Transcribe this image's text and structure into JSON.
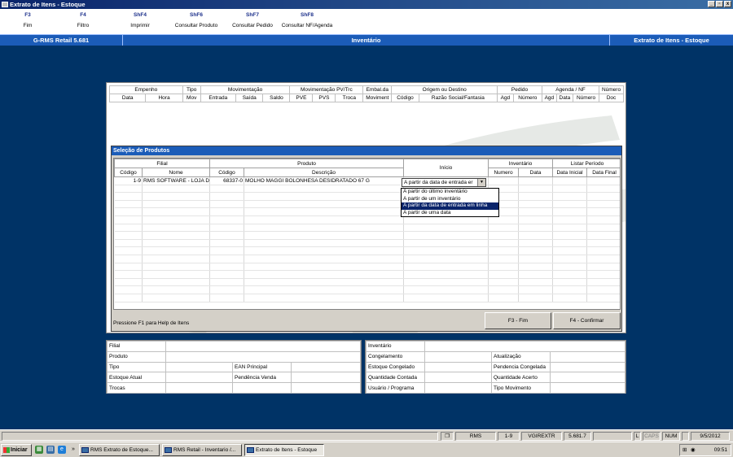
{
  "window": {
    "title": "Extrato de Itens - Estoque",
    "minimize": "_",
    "restore": "▫",
    "close": "x"
  },
  "fkeys": [
    {
      "key": "F3",
      "label": "Fim"
    },
    {
      "key": "F4",
      "label": "Filtro"
    },
    {
      "key": "ShF4",
      "label": "Imprimir"
    },
    {
      "key": "ShF6",
      "label": "Consultar Produto"
    },
    {
      "key": "ShF7",
      "label": "Consultar Pedido"
    },
    {
      "key": "ShF8",
      "label": "Consultar NF/Agenda"
    }
  ],
  "module": {
    "system": "G-RMS Retail 5.681",
    "area": "Inventário",
    "screen": "Extrato de Itens - Estoque"
  },
  "grid1": {
    "groups": [
      "Empenho",
      "Tipo",
      "Movimentação",
      "Movimentação PV/Trc",
      "Embal.da",
      "Origem ou Destino",
      "Pedido",
      "Agenda / NF",
      "Número"
    ],
    "columns": [
      "Data",
      "Hora",
      "Mov",
      "Entrada",
      "Saída",
      "Saldo",
      "PVE",
      "PVS",
      "Troca",
      "Moviment",
      "Código",
      "Razão Social/Fantasia",
      "Agd",
      "Número",
      "Agd",
      "Data",
      "Número",
      "Doc"
    ]
  },
  "dialog": {
    "title": "Seleção de Produtos",
    "groups": {
      "filial": "Filial",
      "produto": "Produto",
      "inicio": "Início",
      "inventario": "Inventário",
      "periodo": "Listar Período"
    },
    "columns": [
      "Código",
      "Nome",
      "Código",
      "Descrição",
      "Numero",
      "Data",
      "Data Inicial",
      "Data Final"
    ],
    "row": {
      "filial_codigo": "1-9",
      "filial_nome": "RMS SOFTWARE - LOJA D",
      "produto_codigo": "68337-0",
      "produto_descricao": "MOLHO MAGGI BOLONHESA DESIDRATADO 67 G",
      "inicio": "A partir da data de entrada er"
    },
    "options": [
      "A partir do último inventário",
      "A partir de um inventário",
      "A partir da data de entrada em linha",
      "A partir de uma data"
    ],
    "selected_option_index": 2,
    "status": "Pressione F1 para Help de Itens",
    "btn_fim": "F3 - Fim",
    "btn_confirmar": "F4 - Confirmar"
  },
  "info_left": {
    "filial": "Filial",
    "produto": "Produto",
    "tipo": "Tipo",
    "ean": "EAN Principal",
    "estoque_atual": "Estoque Atual",
    "pendencia_venda": "Pendência Venda",
    "trocas": "Trocas"
  },
  "info_right": {
    "inventario": "Inventário",
    "congelamento": "Congelamento",
    "atualizacao": "Atualização",
    "estoque_congelado": "Estoque Congelado",
    "pendencia_congelada": "Pendencia Congelada",
    "quantidade_contada": "Quantidade Contada",
    "quantidade_acerto": "Quantidade Acerto",
    "usuario_programa": "Usuário / Programa",
    "tipo_movimento": "Tipo Movimento"
  },
  "statusbar": {
    "company": "RMS",
    "filial": "1-9",
    "program": "VGIREXTR",
    "version": "5.681.7",
    "l": "L",
    "caps": "CAPS",
    "num": "NUM",
    "date": "9/5/2012"
  },
  "taskbar": {
    "start": "Iniciar",
    "chevron": "»",
    "tasks": [
      "RMS Extrato de Estoque...",
      "RMS Retail - Inventario /...",
      "Extrato de Itens - Estoque"
    ],
    "clock": "09:51"
  }
}
